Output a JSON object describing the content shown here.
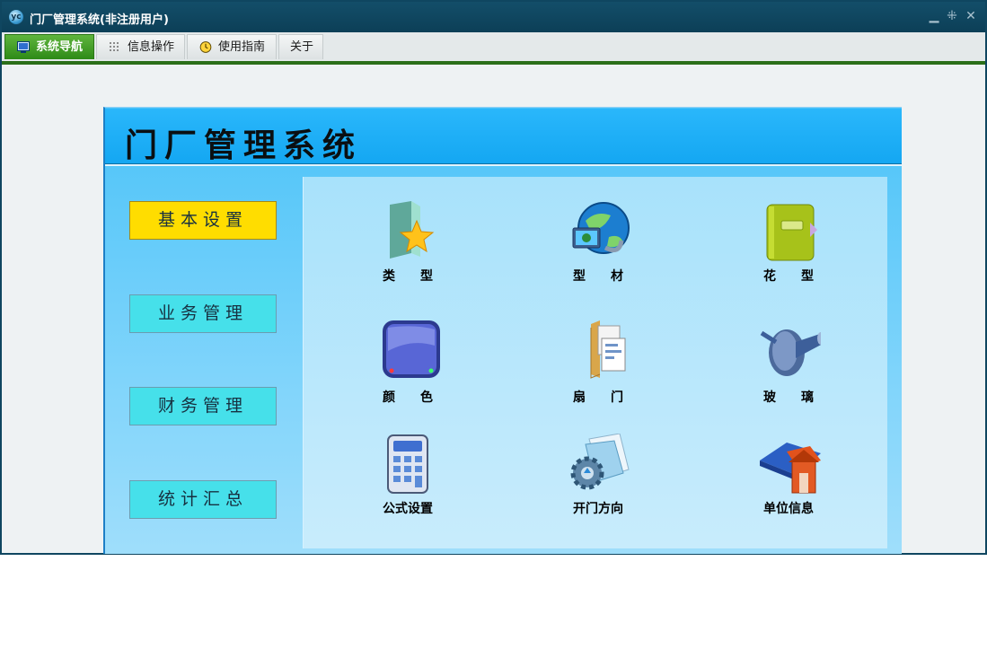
{
  "window": {
    "title": "门厂管理系统(非注册用户)",
    "app_icon_text": "yc",
    "controls": {
      "minimize": "▁",
      "restore": "⁜",
      "close": "✕"
    }
  },
  "tabs": [
    {
      "label": "系统导航",
      "icon": "monitor-icon",
      "active": true
    },
    {
      "label": "信息操作",
      "icon": "grid-icon",
      "active": false
    },
    {
      "label": "使用指南",
      "icon": "clock-icon",
      "active": false
    },
    {
      "label": "关于",
      "icon": "",
      "active": false
    }
  ],
  "banner": {
    "title": "门厂管理系统"
  },
  "sidebar": {
    "items": [
      {
        "label": "基本设置",
        "active": true
      },
      {
        "label": "业务管理",
        "active": false
      },
      {
        "label": "财务管理",
        "active": false
      },
      {
        "label": "统计汇总",
        "active": false
      }
    ]
  },
  "modules": [
    {
      "label": "类　　型",
      "icon": "star-folder-icon"
    },
    {
      "label": "型　　材",
      "icon": "globe-monitor-icon"
    },
    {
      "label": "花　　型",
      "icon": "notebook-icon"
    },
    {
      "label": "颜　　色",
      "icon": "color-screen-icon"
    },
    {
      "label": "扇　　门",
      "icon": "document-folder-icon"
    },
    {
      "label": "玻　　璃",
      "icon": "telescope-icon"
    },
    {
      "label": "公式设置",
      "icon": "calculator-icon"
    },
    {
      "label": "开门方向",
      "icon": "gear-paper-icon"
    },
    {
      "label": "单位信息",
      "icon": "house-book-icon"
    }
  ],
  "colors": {
    "titlebar": "#0f4660",
    "active_tab": "#3a9a1e",
    "banner": "#14a7f2",
    "sidebar_active": "#ffdd00",
    "sidebar_button": "#46e0ea"
  }
}
